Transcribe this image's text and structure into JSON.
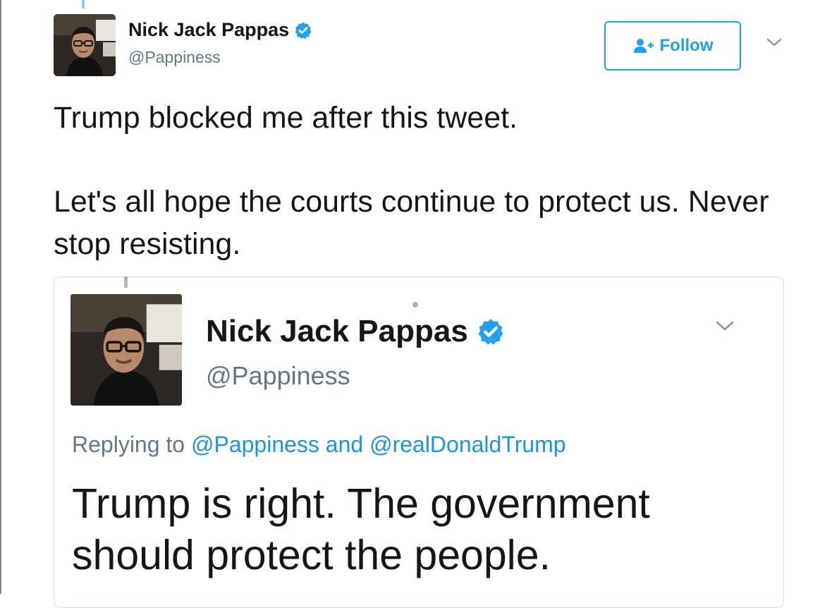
{
  "author": {
    "display_name": "Nick Jack Pappas",
    "handle": "@Pappiness",
    "verified": true,
    "avatar_icon": "profile-photo"
  },
  "actions": {
    "follow_label": "Follow",
    "follow_icon": "add-person-icon",
    "menu_icon": "chevron-down-icon"
  },
  "tweet": {
    "line1": "Trump blocked me after this tweet.",
    "line2": "Let's all hope the courts continue to protect us. Never stop resisting."
  },
  "quoted_tweet": {
    "display_name": "Nick Jack Pappas",
    "handle": "@Pappiness",
    "verified": true,
    "replying_prefix": "Replying to",
    "replying_mentions": [
      "@Pappiness",
      "@realDonaldTrump"
    ],
    "replying_joiner": "and",
    "text": "Trump is right. The government should protect the people."
  },
  "colors": {
    "accent": "#1da1f2",
    "mention": "#1b95e0",
    "text": "#14171a",
    "secondary": "#657786",
    "border": "#d8dee3"
  }
}
